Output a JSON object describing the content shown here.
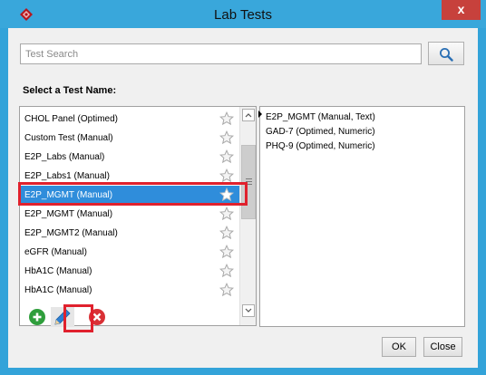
{
  "window": {
    "title": "Lab Tests",
    "close_glyph": "x"
  },
  "search": {
    "placeholder": "Test Search"
  },
  "section_label": "Select a Test Name:",
  "tests": [
    {
      "label": "CHOL Panel (Optimed)",
      "selected": false
    },
    {
      "label": "Custom Test (Manual)",
      "selected": false
    },
    {
      "label": "E2P_Labs (Manual)",
      "selected": false
    },
    {
      "label": "E2P_Labs1 (Manual)",
      "selected": false
    },
    {
      "label": "E2P_MGMT (Manual)",
      "selected": true
    },
    {
      "label": "E2P_MGMT (Manual)",
      "selected": false
    },
    {
      "label": "E2P_MGMT2 (Manual)",
      "selected": false
    },
    {
      "label": "eGFR (Manual)",
      "selected": false
    },
    {
      "label": "HbA1C (Manual)",
      "selected": false
    },
    {
      "label": "HbA1C (Manual)",
      "selected": false
    }
  ],
  "details": [
    "E2P_MGMT (Manual, Text)",
    "GAD-7 (Optimed, Numeric)",
    "PHQ-9 (Optimed, Numeric)"
  ],
  "buttons": {
    "ok": "OK",
    "close": "Close"
  },
  "icons": {
    "app": "diamond-logo-icon",
    "search": "magnifier-icon",
    "favorite": "star-outline-icon",
    "add": "plus-circle-icon",
    "edit": "pencil-icon",
    "delete": "x-circle-icon"
  },
  "colors": {
    "title_bar": "#39a7db",
    "selection": "#2f8ddb",
    "highlight": "#e0212d",
    "add": "#2f9e3c",
    "delete": "#d93035"
  }
}
